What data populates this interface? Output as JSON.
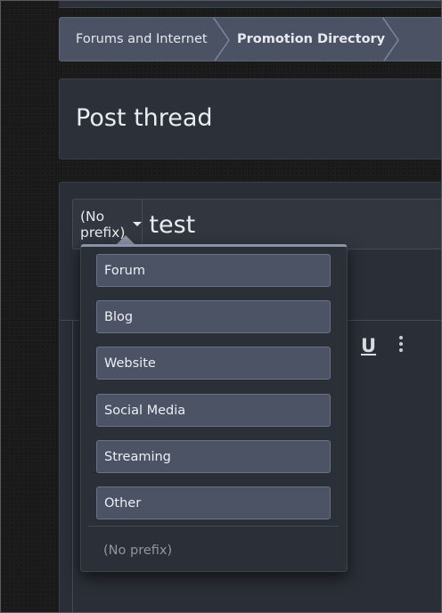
{
  "breadcrumb": {
    "items": [
      "Forums and Internet",
      "Promotion Directory"
    ]
  },
  "page": {
    "title": "Post thread"
  },
  "form": {
    "prefix_label": "(No prefix)",
    "title_value": "test",
    "toolbar": {
      "underline_label": "U",
      "more_icon": "vertical-ellipsis-icon"
    }
  },
  "prefix_menu": {
    "options": [
      "Forum",
      "Blog",
      "Website",
      "Social Media",
      "Streaming",
      "Other"
    ],
    "no_prefix_label": "(No prefix)"
  },
  "colors": {
    "breadcrumb_bg": "#4a5264",
    "option_bg": "#4b5365",
    "panel_bg": "#2c3038"
  }
}
